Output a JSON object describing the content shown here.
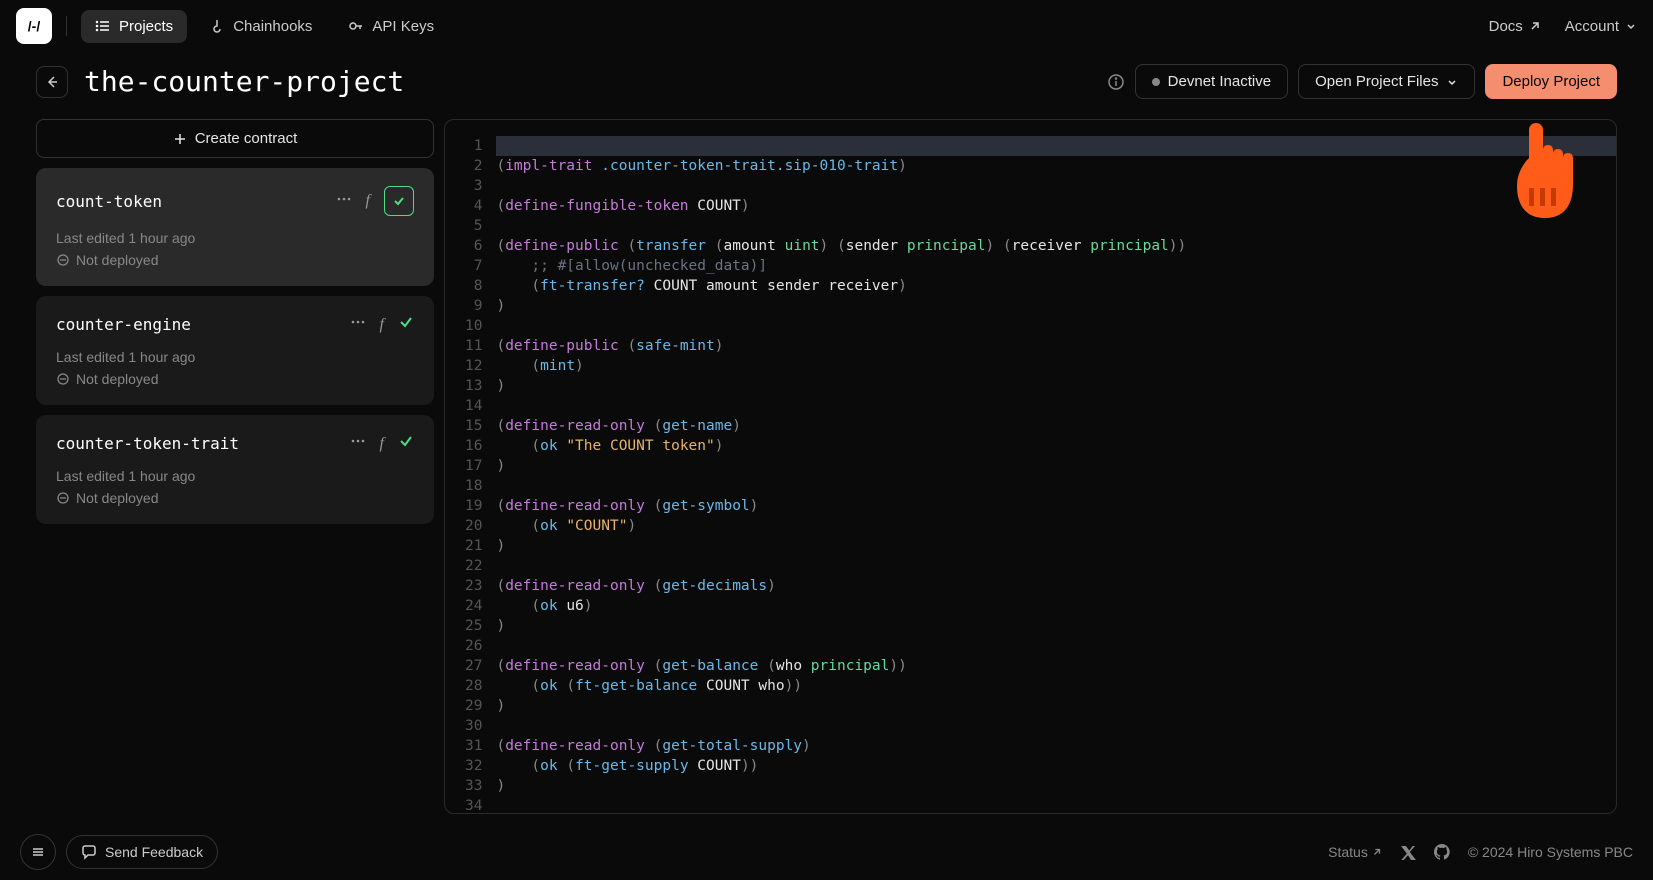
{
  "nav": {
    "projects": "Projects",
    "chainhooks": "Chainhooks",
    "apikeys": "API Keys",
    "docs": "Docs",
    "account": "Account"
  },
  "header": {
    "title": "the-counter-project",
    "devnet": "Devnet Inactive",
    "open_files": "Open Project Files",
    "deploy": "Deploy Project"
  },
  "sidebar": {
    "create": "Create contract",
    "contracts": [
      {
        "name": "count-token",
        "edited": "Last edited 1 hour ago",
        "status": "Not deployed"
      },
      {
        "name": "counter-engine",
        "edited": "Last edited 1 hour ago",
        "status": "Not deployed"
      },
      {
        "name": "counter-token-trait",
        "edited": "Last edited 1 hour ago",
        "status": "Not deployed"
      }
    ]
  },
  "code": {
    "l2": {
      "a": "impl-trait",
      "b": ".counter-token-trait.sip-010-trait"
    },
    "l4": {
      "a": "define-fungible-token",
      "b": "COUNT"
    },
    "l6": {
      "a": "define-public",
      "b": "transfer",
      "c": "amount",
      "d": "uint",
      "e": "sender",
      "f": "principal",
      "g": "receiver",
      "h": "principal"
    },
    "l7": ";; #[allow(unchecked_data)]",
    "l8": {
      "a": "ft-transfer?",
      "b": "COUNT amount sender receiver"
    },
    "l11": {
      "a": "define-public",
      "b": "safe-mint"
    },
    "l12": {
      "a": "mint"
    },
    "l15": {
      "a": "define-read-only",
      "b": "get-name"
    },
    "l16": {
      "a": "ok",
      "b": "\"The COUNT token\""
    },
    "l19": {
      "a": "define-read-only",
      "b": "get-symbol"
    },
    "l20": {
      "a": "ok",
      "b": "\"COUNT\""
    },
    "l23": {
      "a": "define-read-only",
      "b": "get-decimals"
    },
    "l24": {
      "a": "ok",
      "b": "u6"
    },
    "l27": {
      "a": "define-read-only",
      "b": "get-balance",
      "c": "who",
      "d": "principal"
    },
    "l28": {
      "a": "ok",
      "b": "ft-get-balance",
      "c": "COUNT who"
    },
    "l31": {
      "a": "define-read-only",
      "b": "get-total-supply"
    },
    "l32": {
      "a": "ok",
      "b": "ft-get-supply",
      "c": "COUNT"
    }
  },
  "footer": {
    "feedback": "Send Feedback",
    "status": "Status",
    "copyright": "© 2024 Hiro Systems PBC"
  }
}
